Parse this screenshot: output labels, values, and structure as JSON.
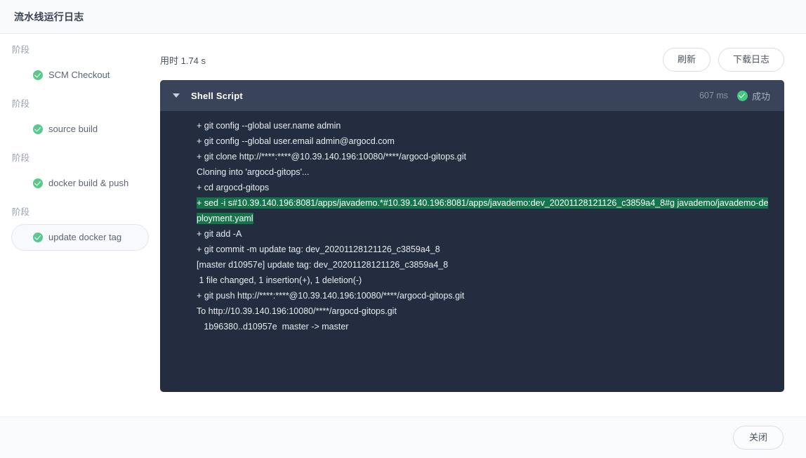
{
  "dialog": {
    "title": "流水线运行日志"
  },
  "sidebar": {
    "groups": [
      {
        "label": "阶段",
        "item": "SCM Checkout",
        "selected": false
      },
      {
        "label": "阶段",
        "item": "source build",
        "selected": false
      },
      {
        "label": "阶段",
        "item": "docker build & push",
        "selected": false
      },
      {
        "label": "阶段",
        "item": "update docker tag",
        "selected": true
      }
    ]
  },
  "main": {
    "elapsed": "用时 1.74 s",
    "refresh_label": "刷新",
    "download_label": "下载日志"
  },
  "log": {
    "step_title": "Shell Script",
    "duration": "607 ms",
    "status_text": "成功",
    "lines": [
      {
        "text": "+ git config --global user.name admin",
        "highlight": false
      },
      {
        "text": "+ git config --global user.email admin@argocd.com",
        "highlight": false
      },
      {
        "text": "+ git clone http://****:****@10.39.140.196:10080/****/argocd-gitops.git",
        "highlight": false
      },
      {
        "text": "Cloning into 'argocd-gitops'...",
        "highlight": false
      },
      {
        "text": "+ cd argocd-gitops",
        "highlight": false
      },
      {
        "text": "+ sed -i s#10.39.140.196:8081/apps/javademo.*#10.39.140.196:8081/apps/javademo:dev_20201128121126_c3859a4_8#g javademo/javademo-deployment.yaml",
        "highlight": true
      },
      {
        "text": "+ git add -A",
        "highlight": false
      },
      {
        "text": "+ git commit -m update tag: dev_20201128121126_c3859a4_8",
        "highlight": false
      },
      {
        "text": "[master d10957e] update tag: dev_20201128121126_c3859a4_8",
        "highlight": false
      },
      {
        "text": " 1 file changed, 1 insertion(+), 1 deletion(-)",
        "highlight": false
      },
      {
        "text": "+ git push http://****:****@10.39.140.196:10080/****/argocd-gitops.git",
        "highlight": false
      },
      {
        "text": "To http://10.39.140.196:10080/****/argocd-gitops.git",
        "highlight": false
      },
      {
        "text": "   1b96380..d10957e  master -> master",
        "highlight": false
      }
    ]
  },
  "footer": {
    "close_label": "关闭"
  },
  "colors": {
    "panel_bg": "#242d40",
    "panel_header_bg": "#39435a",
    "success_green": "#43c97f",
    "highlight_green": "#15754a",
    "titlebar_bg": "#f8fafc"
  }
}
